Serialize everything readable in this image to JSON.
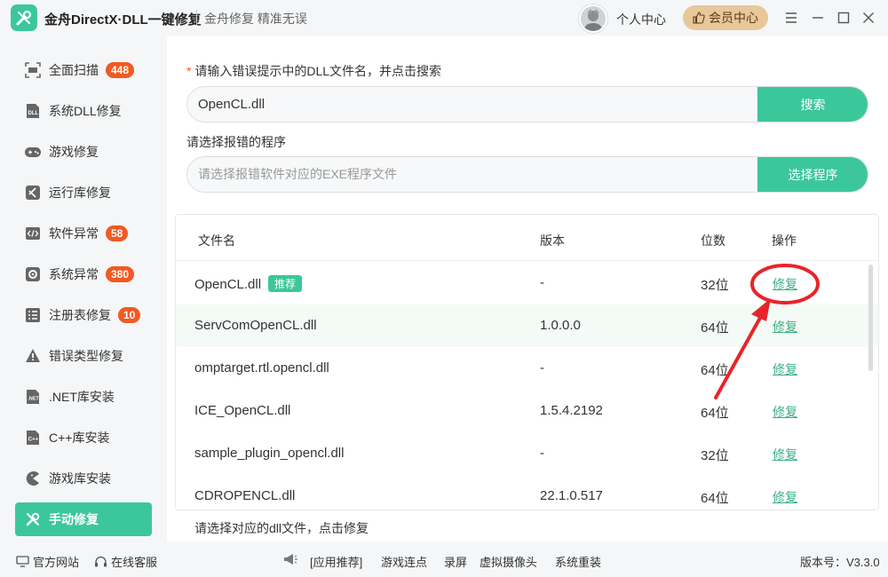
{
  "titlebar": {
    "app_title": "金舟DirectX·DLL一键修复",
    "slogan": "金舟修复 精准无误",
    "user_center": "个人中心",
    "vip_label": "会员中心"
  },
  "sidebar": {
    "items": [
      {
        "label": "全面扫描",
        "badge": "448",
        "icon": "scan-icon"
      },
      {
        "label": "系统DLL修复",
        "badge": "",
        "icon": "dll-icon"
      },
      {
        "label": "游戏修复",
        "badge": "",
        "icon": "gamepad-icon"
      },
      {
        "label": "运行库修复",
        "badge": "",
        "icon": "vs-icon"
      },
      {
        "label": "软件异常",
        "badge": "58",
        "icon": "code-icon"
      },
      {
        "label": "系统异常",
        "badge": "380",
        "icon": "gear-icon"
      },
      {
        "label": "注册表修复",
        "badge": "10",
        "icon": "list-icon"
      },
      {
        "label": "错误类型修复",
        "badge": "",
        "icon": "warning-icon"
      },
      {
        "label": ".NET库安装",
        "badge": "",
        "icon": "net-icon"
      },
      {
        "label": "C++库安装",
        "badge": "",
        "icon": "cpp-icon"
      },
      {
        "label": "游戏库安装",
        "badge": "",
        "icon": "pacman-icon"
      },
      {
        "label": "手动修复",
        "badge": "",
        "icon": "wrench-icon"
      }
    ]
  },
  "main": {
    "search_label_req": "*",
    "search_label": "请输入错误提示中的DLL文件名，并点击搜索",
    "search_value": "OpenCL.dll",
    "search_button": "搜索",
    "program_label": "请选择报错的程序",
    "program_placeholder": "请选择报错软件对应的EXE程序文件",
    "program_button": "选择程序",
    "table": {
      "headers": {
        "name": "文件名",
        "version": "版本",
        "bits": "位数",
        "action": "操作"
      },
      "recommend_tag": "推荐",
      "rows": [
        {
          "name": "OpenCL.dll",
          "version": "-",
          "bits": "32位",
          "action": "修复"
        },
        {
          "name": "ServComOpenCL.dll",
          "version": "1.0.0.0",
          "bits": "64位",
          "action": "修复"
        },
        {
          "name": "omptarget.rtl.opencl.dll",
          "version": "-",
          "bits": "64位",
          "action": "修复"
        },
        {
          "name": "ICE_OpenCL.dll",
          "version": "1.5.4.2192",
          "bits": "64位",
          "action": "修复"
        },
        {
          "name": "sample_plugin_opencl.dll",
          "version": "-",
          "bits": "32位",
          "action": "修复"
        },
        {
          "name": "CDROPENCL.dll",
          "version": "22.1.0.517",
          "bits": "64位",
          "action": "修复"
        }
      ]
    },
    "hint": "请选择对应的dll文件，点击修复"
  },
  "bottombar": {
    "official_site": "官方网站",
    "online_service": "在线客服",
    "recommend": "[应用推荐]",
    "links": [
      "游戏连点",
      "录屏",
      "虚拟摄像头",
      "系统重装"
    ],
    "version": "版本号：V3.3.0"
  },
  "colors": {
    "accent": "#3cc79b",
    "badge": "#f05a23",
    "vip": "#e8c79b",
    "annotation": "#e8242a"
  }
}
